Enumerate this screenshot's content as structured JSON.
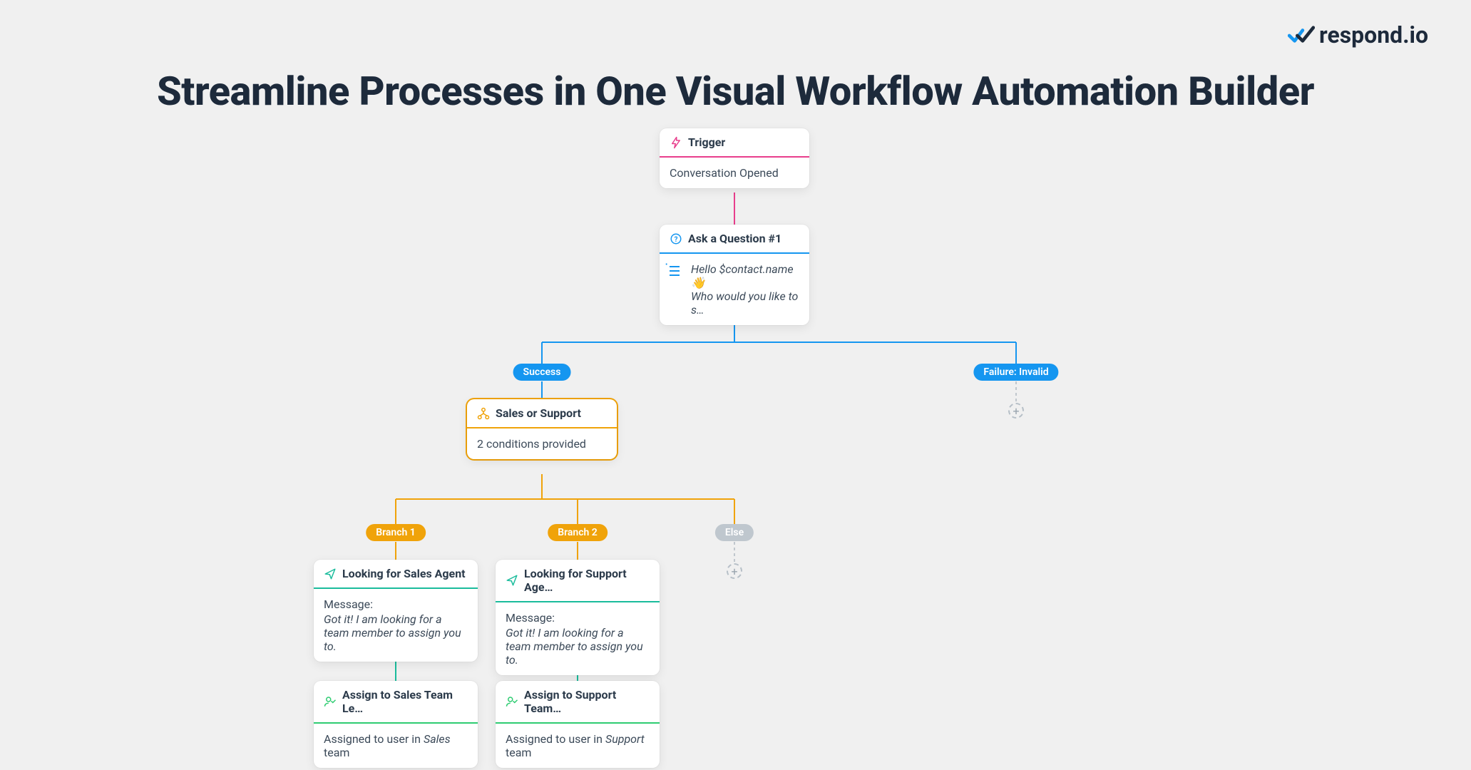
{
  "brand": {
    "name": "respond.io"
  },
  "headline": "Streamline Processes in One Visual Workflow Automation Builder",
  "workflow": {
    "trigger": {
      "title": "Trigger",
      "body": "Conversation Opened"
    },
    "ask": {
      "title": "Ask a Question #1",
      "line1": "Hello $contact.name 👋",
      "line2": "Who would you like to s…"
    },
    "branch_labels": {
      "success": "Success",
      "failure": "Failure: Invalid"
    },
    "condition": {
      "title": "Sales or Support",
      "body": "2 conditions provided"
    },
    "cond_labels": {
      "b1": "Branch 1",
      "b2": "Branch 2",
      "else": "Else"
    },
    "msg_sales": {
      "title": "Looking for Sales Agent",
      "label": "Message:",
      "body": "Got it! I am looking for a team member to assign you to."
    },
    "msg_support": {
      "title": "Looking for Support Age…",
      "label": "Message:",
      "body": "Got it! I am looking for a team member to assign you to."
    },
    "assign_sales": {
      "title": "Assign to Sales Team Le…",
      "pre": "Assigned to user in ",
      "team": "Sales",
      "post": " team"
    },
    "assign_support": {
      "title": "Assign to Support Team…",
      "pre": "Assigned to user in ",
      "team": "Support",
      "post": " team"
    }
  }
}
